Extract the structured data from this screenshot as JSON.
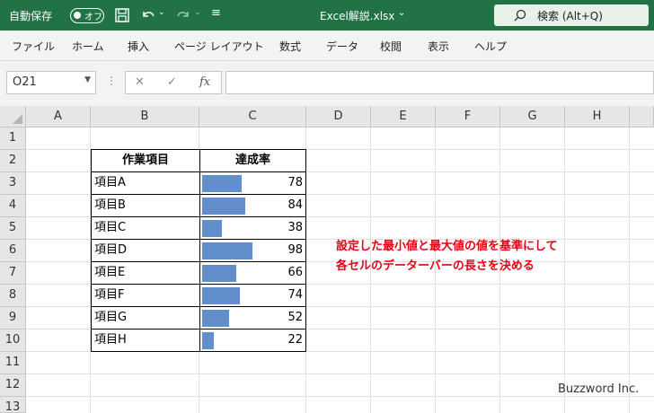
{
  "titlebar": {
    "autosave_label": "自動保存",
    "autosave_state": "オフ",
    "filename": "Excel解説.xlsx",
    "search_placeholder": "検索 (Alt+Q)"
  },
  "menu": [
    "ファイル",
    "ホーム",
    "挿入",
    "ページ レイアウト",
    "数式",
    "データ",
    "校閲",
    "表示",
    "ヘルプ"
  ],
  "formula_bar": {
    "name_box": "O21",
    "fx_label": "fx",
    "formula": ""
  },
  "columns": [
    "A",
    "B",
    "C",
    "D",
    "E",
    "F",
    "G",
    "H"
  ],
  "rows": [
    "1",
    "2",
    "3",
    "4",
    "5",
    "6",
    "7",
    "8",
    "9",
    "10",
    "11",
    "12",
    "13"
  ],
  "table": {
    "header_item": "作業項目",
    "header_rate": "達成率",
    "rows": [
      {
        "name": "項目A",
        "value": "78"
      },
      {
        "name": "項目B",
        "value": "84"
      },
      {
        "name": "項目C",
        "value": "38"
      },
      {
        "name": "項目D",
        "value": "98"
      },
      {
        "name": "項目E",
        "value": "66"
      },
      {
        "name": "項目F",
        "value": "74"
      },
      {
        "name": "項目G",
        "value": "52"
      },
      {
        "name": "項目H",
        "value": "22"
      }
    ]
  },
  "note": {
    "line1": "設定した最小値と最大値の値を基準にして",
    "line2": "各セルのデーターバーの長さを決める"
  },
  "watermark": "Buzzword Inc.",
  "colors": {
    "title_green": "#217346",
    "databar": "#628ecc",
    "note_red": "#e60012"
  }
}
